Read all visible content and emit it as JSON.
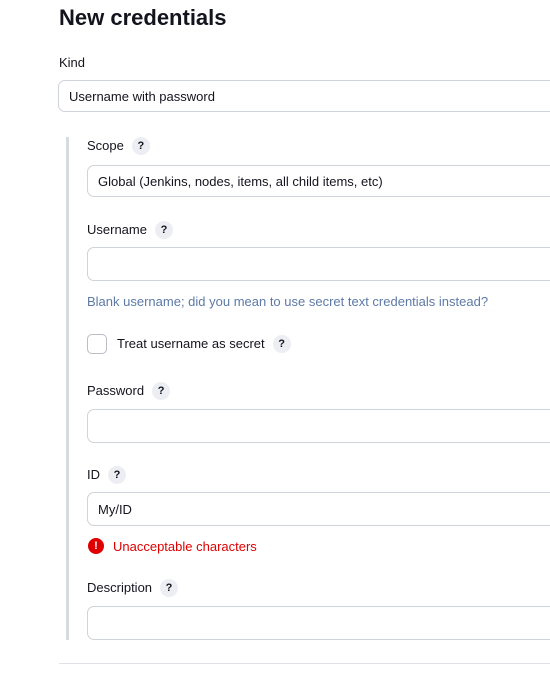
{
  "page": {
    "title": "New credentials"
  },
  "kind": {
    "label": "Kind",
    "value": "Username with password"
  },
  "scope": {
    "label": "Scope",
    "help": "?",
    "value": "Global (Jenkins, nodes, items, all child items, etc)"
  },
  "username": {
    "label": "Username",
    "help": "?",
    "value": "",
    "hint": "Blank username; did you mean to use secret text credentials instead?"
  },
  "treat_secret": {
    "label": "Treat username as secret",
    "help": "?",
    "checked": false
  },
  "password": {
    "label": "Password",
    "help": "?",
    "value": ""
  },
  "id": {
    "label": "ID",
    "help": "?",
    "value": "My/ID",
    "error": "Unacceptable characters",
    "error_icon": "!"
  },
  "description": {
    "label": "Description",
    "help": "?",
    "value": ""
  },
  "colors": {
    "error": "#e00000",
    "hint": "#5d7aa6",
    "help_bg": "#eceef3"
  }
}
